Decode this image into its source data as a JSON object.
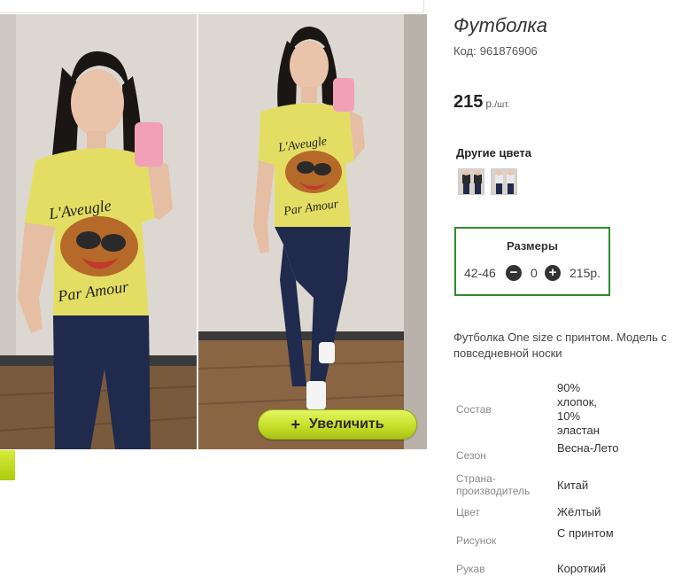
{
  "colors": {
    "accent_green": "#2e8b2e",
    "zoom_button": "#c6e02a",
    "shirt": "#e3de63",
    "jeans": "#1f2a4c"
  },
  "gallery": {
    "zoom_icon": "plus-icon",
    "zoom_plus": "+",
    "zoom_label": "Увеличить"
  },
  "product": {
    "title": "Футболка",
    "code_label": "Код:",
    "code_value": "961876906",
    "price_value": "215",
    "price_unit": "р.",
    "price_unit_suffix": "/шт."
  },
  "other_colors": {
    "heading": "Другие цвета",
    "swatches": [
      "swatch-1",
      "swatch-2"
    ]
  },
  "sizes": {
    "heading": "Размеры",
    "size": "42-46",
    "minus_symbol": "−",
    "quantity": "0",
    "plus_symbol": "+",
    "price": "215р."
  },
  "description": {
    "line1": "Футболка One size с принтом. Модель с",
    "line2": "повседневной носки"
  },
  "specs": [
    {
      "label": "Состав",
      "value": "90% хлопок, 10% эластан"
    },
    {
      "label": "Сезон",
      "value": "Весна-Лето"
    },
    {
      "label": "Страна-производитель",
      "value": "Китай"
    },
    {
      "label": "Цвет",
      "value": "Жёлтый"
    },
    {
      "label": "Рисунок",
      "value": "С принтом"
    },
    {
      "label": "Рукав",
      "value": "Короткий"
    }
  ]
}
